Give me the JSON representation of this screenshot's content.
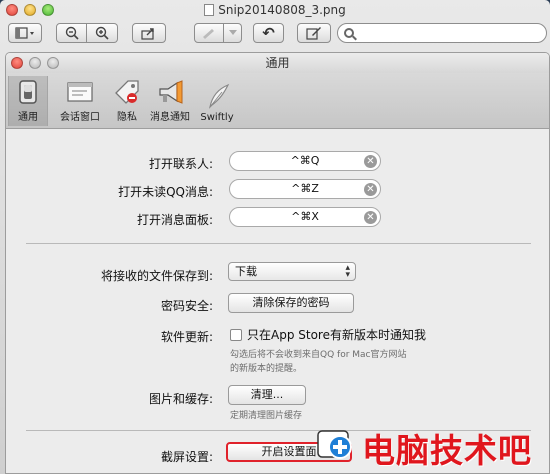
{
  "outer_window": {
    "title": "Snip20140808_3.png",
    "toolbar": {
      "view_label": "",
      "rotate_label": "↶",
      "search_placeholder": ""
    }
  },
  "prefs_window": {
    "title": "通用",
    "tabs": [
      {
        "label": "通用",
        "icon": "switch-icon",
        "selected": true
      },
      {
        "label": "会话窗口",
        "icon": "chat-window-icon",
        "selected": false
      },
      {
        "label": "隐私",
        "icon": "privacy-tag-icon",
        "selected": false
      },
      {
        "label": "消息通知",
        "icon": "megaphone-icon",
        "selected": false
      },
      {
        "label": "Swiftly",
        "icon": "feather-icon",
        "selected": false
      }
    ],
    "shortcuts": [
      {
        "label": "打开联系人:",
        "value": "^⌘Q"
      },
      {
        "label": "打开未读QQ消息:",
        "value": "^⌘Z"
      },
      {
        "label": "打开消息面板:",
        "value": "^⌘X"
      }
    ],
    "save_files": {
      "label": "将接收的文件保存到:",
      "value": "下载"
    },
    "password": {
      "label": "密码安全:",
      "button": "清除保存的密码"
    },
    "update": {
      "label": "软件更新:",
      "checkbox_label": "只在App Store有新版本时通知我",
      "hint_line1": "勾选后将不会收到来自QQ for Mac官方网站",
      "hint_line2": "的新版本的提醒。"
    },
    "cache": {
      "label": "图片和缓存:",
      "button": "清理...",
      "hint": "定期清理图片缓存"
    },
    "screenshot": {
      "label": "截屏设置:",
      "button": "开启设置面"
    }
  },
  "watermark": {
    "text": "电脑技术吧"
  },
  "colors": {
    "highlight": "#e0222b",
    "watermark": "#e0161d"
  }
}
